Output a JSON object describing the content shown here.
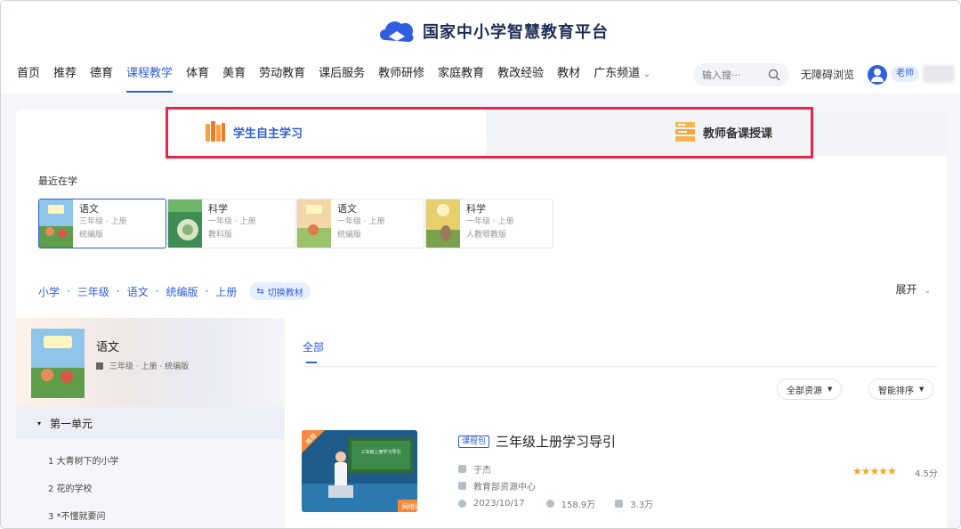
{
  "header": {
    "logo_text": "国家中小学智慧教育平台",
    "nav": [
      "首页",
      "推荐",
      "德育",
      "课程教学",
      "体育",
      "美育",
      "劳动教育",
      "课后服务",
      "教师研修",
      "家庭教育",
      "教改经验",
      "教材",
      "广东频道"
    ],
    "active_nav": "课程教学",
    "search_placeholder": "输入搜···",
    "accessibility": "无障碍浏览",
    "role_badge": "老师"
  },
  "tabs": {
    "student": "学生自主学习",
    "teacher": "教师备课授课"
  },
  "recent": {
    "title": "最近在学",
    "books": [
      {
        "subject": "语文",
        "grade": "三年级 · 上册",
        "edition": "统编版"
      },
      {
        "subject": "科学",
        "grade": "一年级 · 上册",
        "edition": "教科版"
      },
      {
        "subject": "语文",
        "grade": "一年级 · 上册",
        "edition": "统编版"
      },
      {
        "subject": "科学",
        "grade": "一年级 · 上册",
        "edition": "人教鄂教版"
      }
    ]
  },
  "breadcrumb": [
    "小学",
    "三年级",
    "语文",
    "统编版",
    "上册"
  ],
  "switch_label": "切换教材",
  "expand_label": "展开",
  "course": {
    "title": "语文",
    "meta": "三年级 · 上册 · 统编版",
    "unit": "第一单元",
    "lessons": [
      "1 大青树下的小学",
      "2 花的学校",
      "3 *不懂就要问"
    ]
  },
  "content": {
    "filter_tab": "全部",
    "dropdown_resources": "全部资源",
    "dropdown_sort": "智能排序",
    "resource": {
      "tag": "课程包",
      "title": "三年级上册学习导引",
      "thumb_badge": "推荐",
      "thumb_label": "网络课程",
      "thumb_screen_text": "三年级上册学习导引",
      "author": "于杰",
      "source": "教育部资源中心",
      "date": "2023/10/17",
      "views": "158.9万",
      "likes": "3.3万",
      "rating": "4.5分"
    }
  },
  "colors": {
    "accent": "#2f5fe0",
    "highlight_box": "#e8264b",
    "star": "#f4a623"
  }
}
